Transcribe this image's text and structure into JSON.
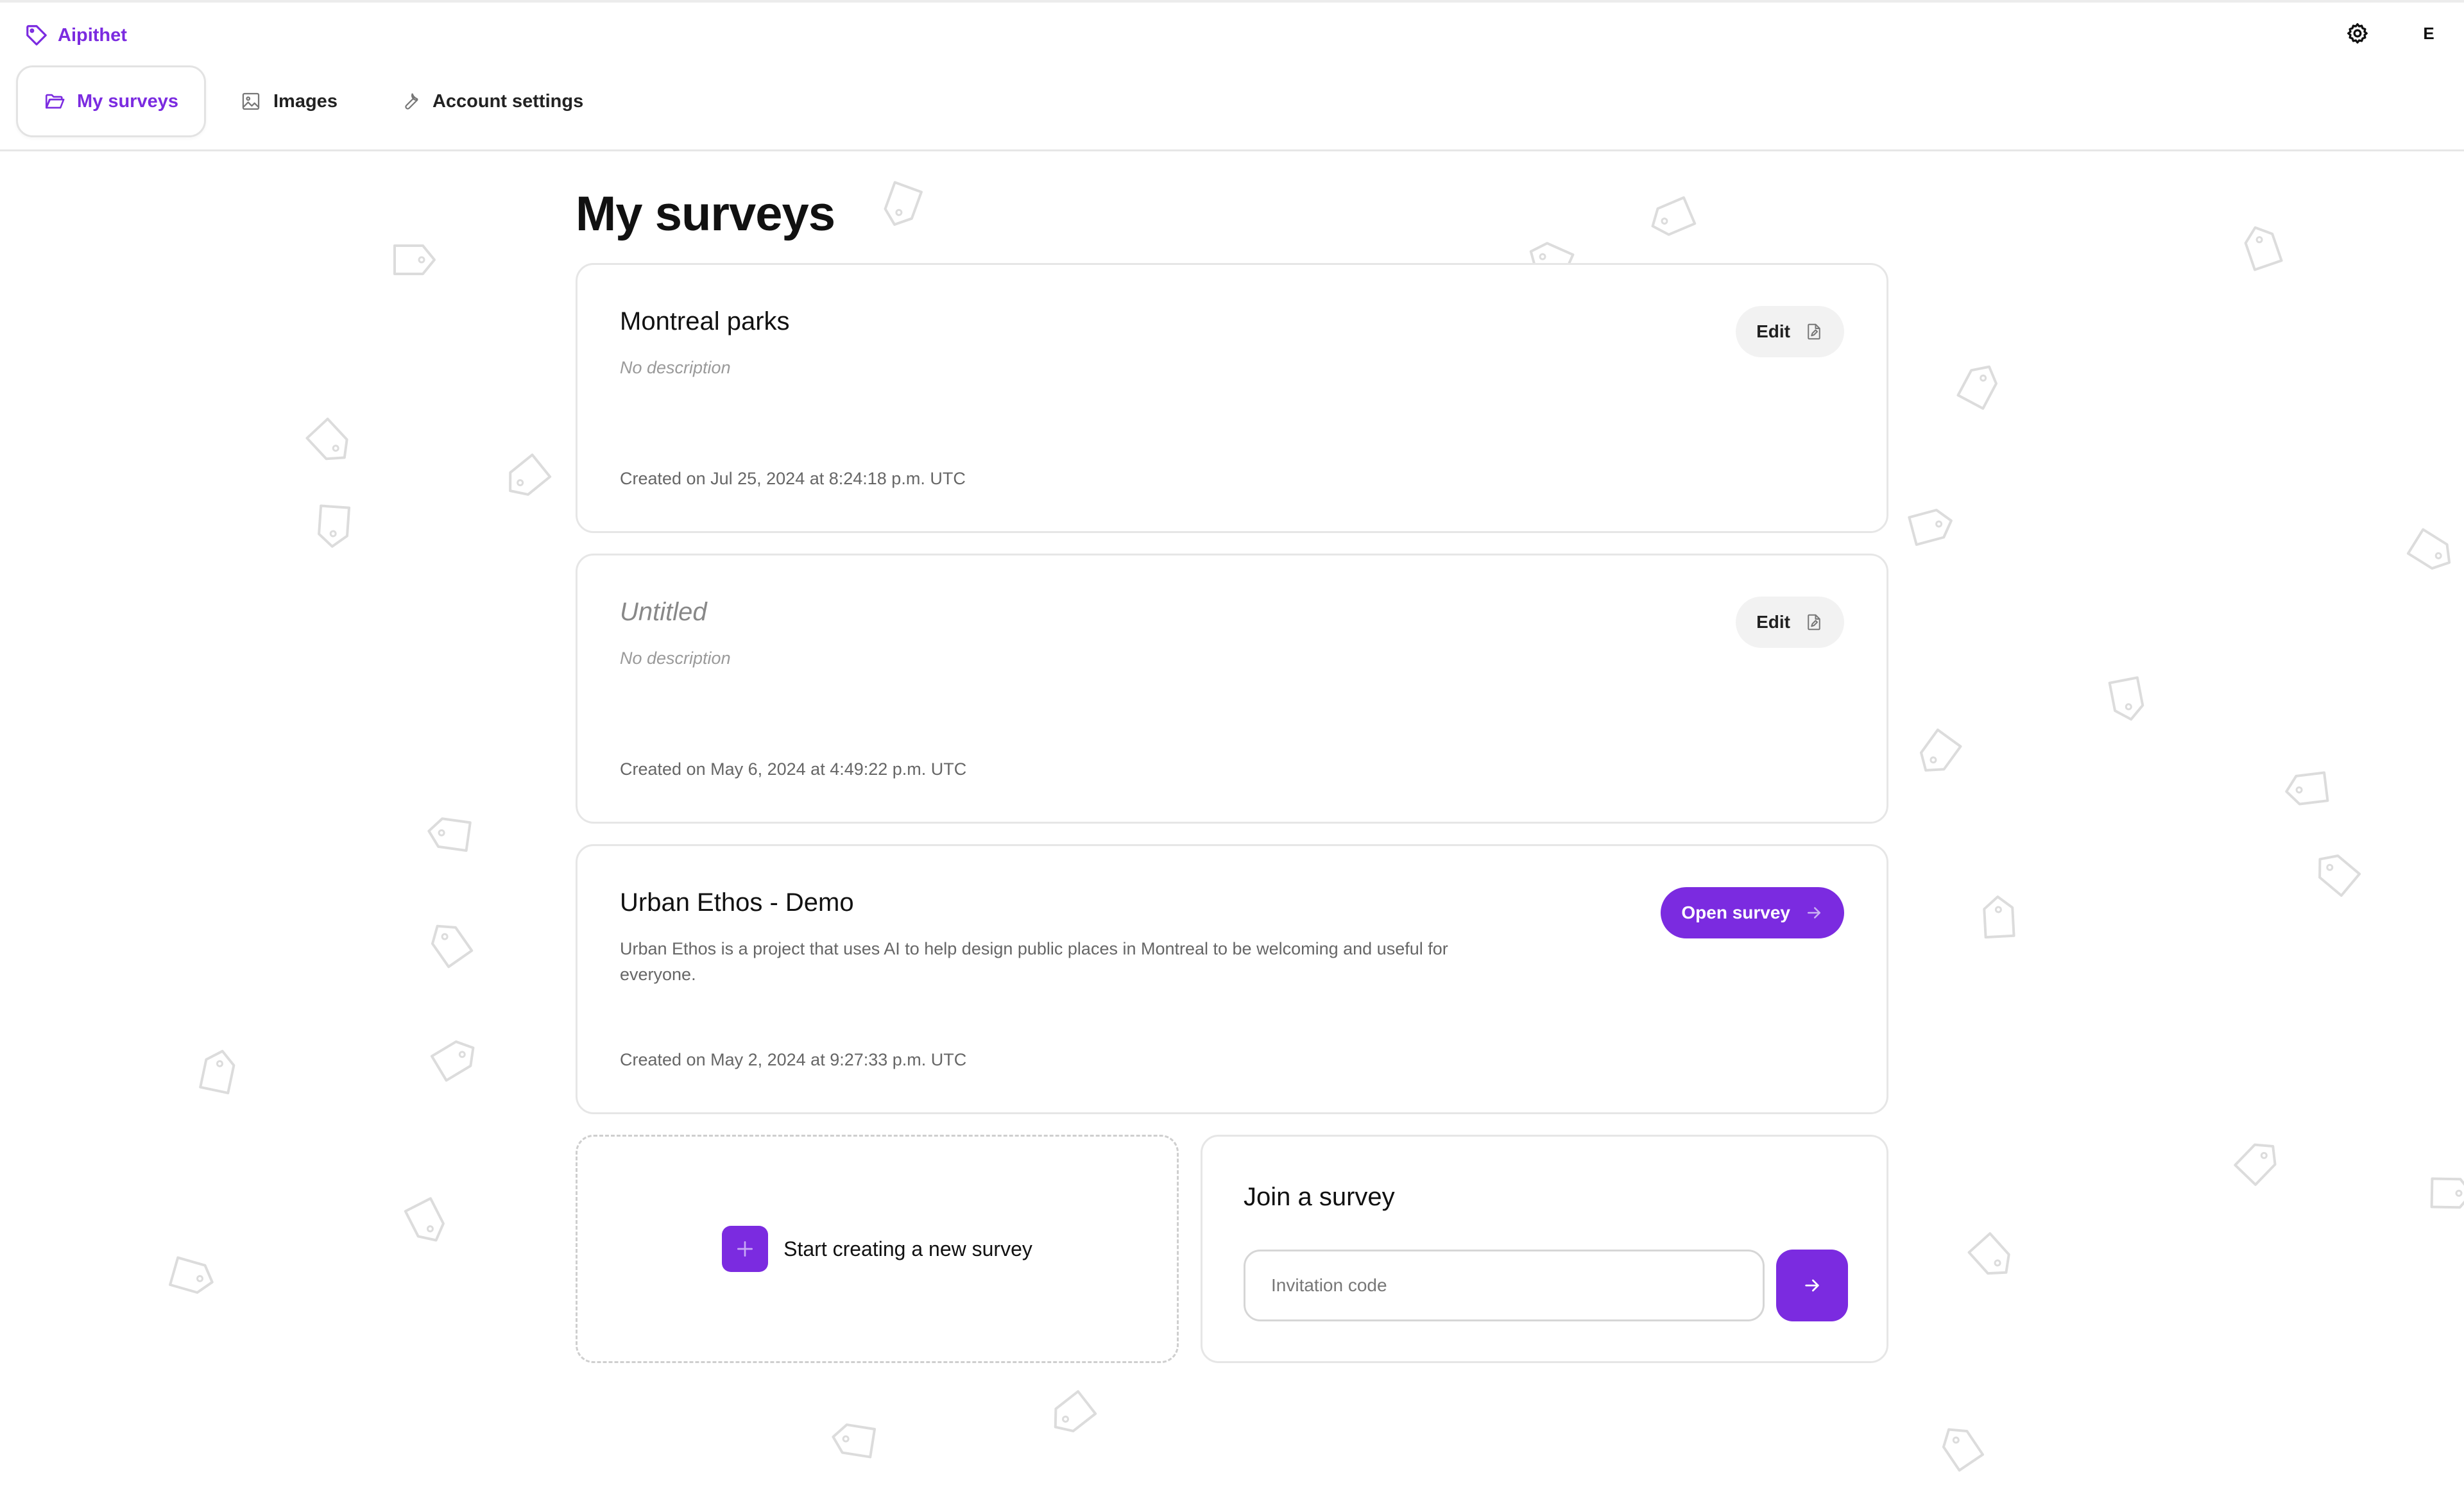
{
  "app": {
    "name": "Aipithet",
    "avatar_initial": "E"
  },
  "nav": {
    "tabs": [
      {
        "label": "My surveys",
        "icon": "folder-open-icon",
        "active": true
      },
      {
        "label": "Images",
        "icon": "image-icon",
        "active": false
      },
      {
        "label": "Account settings",
        "icon": "wrench-icon",
        "active": false
      }
    ]
  },
  "page": {
    "title": "My surveys"
  },
  "surveys": [
    {
      "title": "Montreal parks",
      "description": "No description",
      "created": "Created on Jul 25, 2024 at 8:24:18 p.m. UTC",
      "action": "Edit"
    },
    {
      "title": "Untitled",
      "description": "No description",
      "created": "Created on May 6, 2024 at 4:49:22 p.m. UTC",
      "action": "Edit"
    },
    {
      "title": "Urban Ethos - Demo",
      "description": "Urban Ethos is a project that uses AI to help design public places in Montreal to be welcoming and useful for everyone.",
      "created": "Created on May 2, 2024 at 9:27:33 p.m. UTC",
      "action": "Open survey"
    }
  ],
  "new_survey": {
    "label": "Start creating a new survey"
  },
  "join": {
    "title": "Join a survey",
    "placeholder": "Invitation code",
    "value": ""
  },
  "colors": {
    "accent": "#7b2be0",
    "border": "#e6e6e6",
    "muted_text": "#666666",
    "background_pattern": "#dcdcdc"
  }
}
